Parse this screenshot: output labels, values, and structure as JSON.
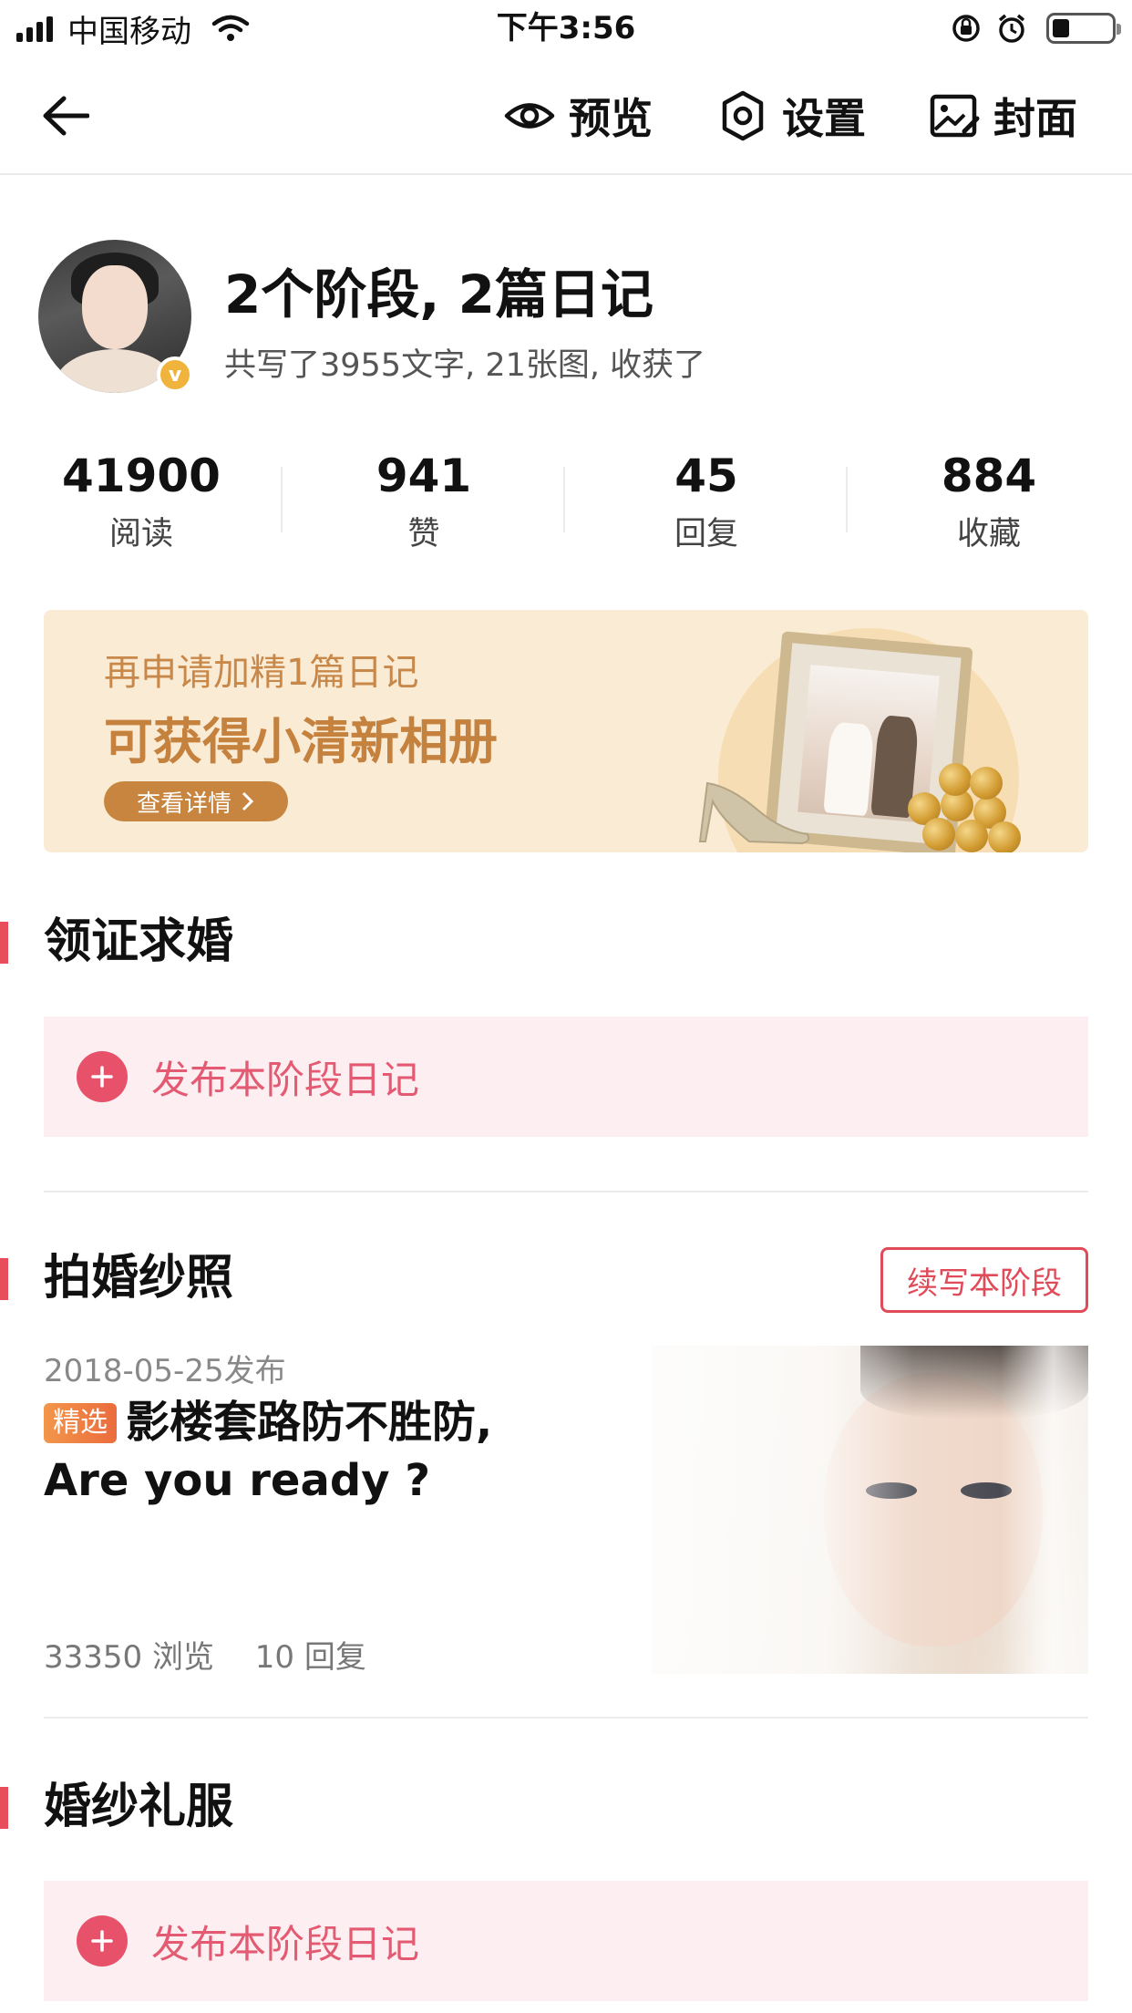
{
  "status_bar": {
    "carrier": "中国移动",
    "time": "下午3:56"
  },
  "nav": {
    "preview_label": "预览",
    "settings_label": "设置",
    "cover_label": "封面"
  },
  "profile": {
    "title": "2个阶段, 2篇日记",
    "subtitle": "共写了3955文字, 21张图, 收获了",
    "verified_mark": "v"
  },
  "stats": [
    {
      "value": "41900",
      "label": "阅读"
    },
    {
      "value": "941",
      "label": "赞"
    },
    {
      "value": "45",
      "label": "回复"
    },
    {
      "value": "884",
      "label": "收藏"
    }
  ],
  "banner": {
    "line1": "再申请加精1篇日记",
    "line2": "可获得小清新相册",
    "button_label": "查看详情"
  },
  "sections": [
    {
      "title": "领证求婚",
      "publish_label": "发布本阶段日记"
    },
    {
      "title": "拍婚纱照",
      "continue_label": "续写本阶段"
    },
    {
      "title": "婚纱礼服",
      "publish_label": "发布本阶段日记"
    }
  ],
  "entry": {
    "date": "2018-05-25发布",
    "badge": "精选",
    "title": "影楼套路防不胜防, Are you ready ?",
    "views": "33350 浏览",
    "replies": "10 回复"
  },
  "colors": {
    "accent": "#e84d5b",
    "publish_bg": "#fceef1",
    "banner_bg": "#faebd4",
    "banner_text": "#c5813e"
  }
}
